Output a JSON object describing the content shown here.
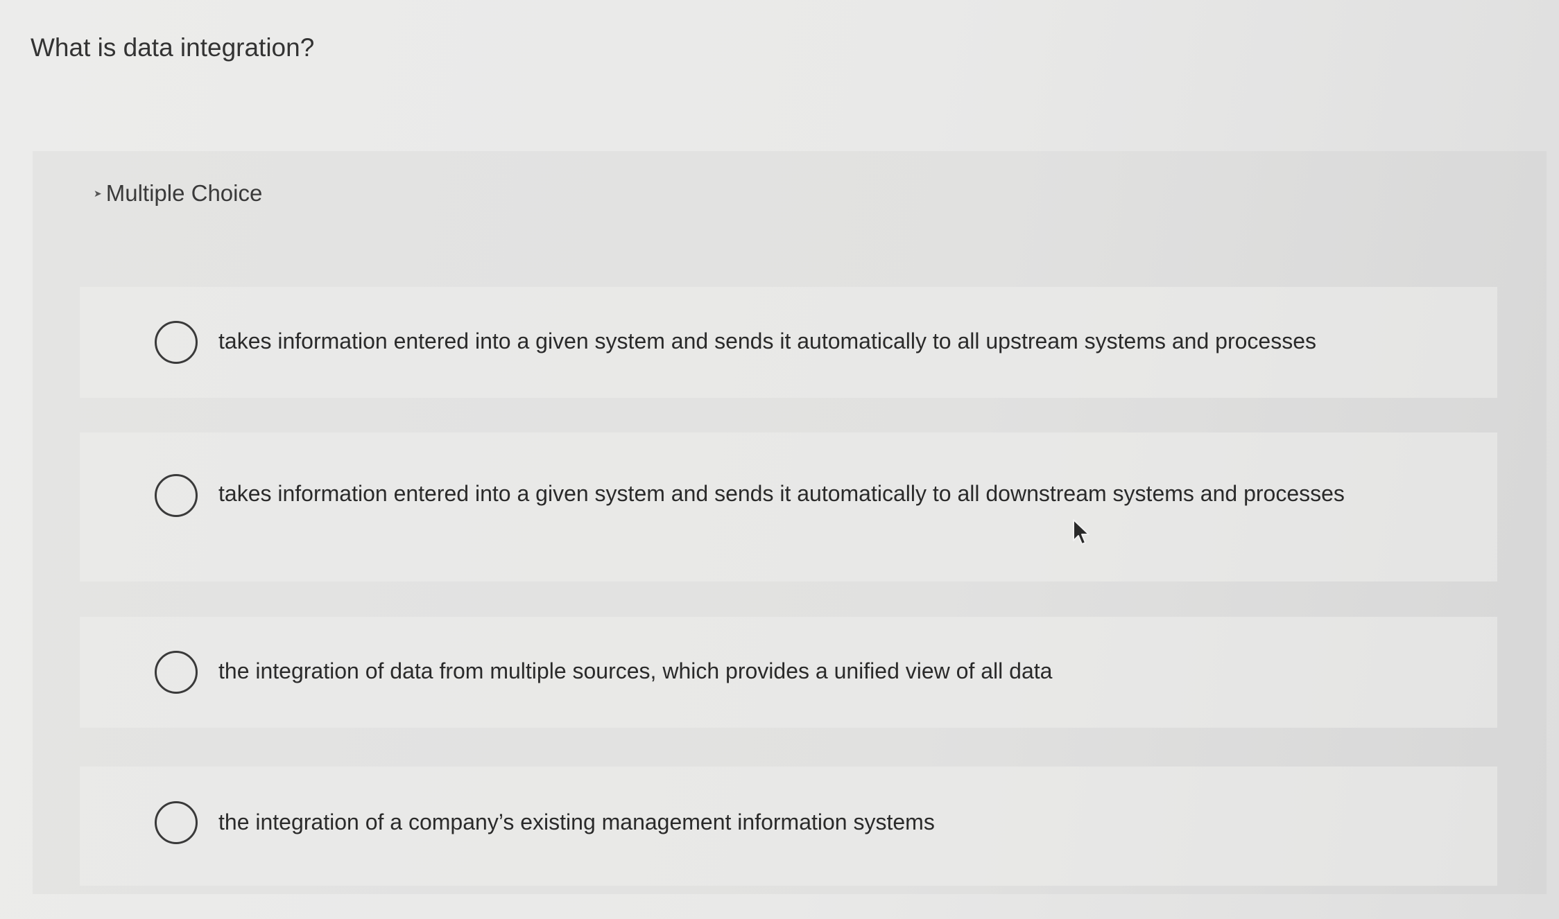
{
  "question": {
    "text": "What is data integration?"
  },
  "question_type": {
    "label": "Multiple Choice"
  },
  "options": [
    {
      "label": "takes information entered into a given system and sends it automatically to all upstream systems and processes",
      "selected": false
    },
    {
      "label": "takes information entered into a given system and sends it automatically to all downstream systems and processes",
      "selected": false
    },
    {
      "label": "the integration of data from multiple sources, which provides a unified view of all data",
      "selected": false
    },
    {
      "label": "the integration of a company’s existing management information systems",
      "selected": false
    }
  ],
  "icons": {
    "radio": "radio-unchecked-icon",
    "cursor": "mouse-pointer-icon"
  },
  "colors": {
    "background": "#e9e9e8",
    "panel": "#e1e1e0",
    "text": "#2a2a2a",
    "radio_border": "#3a3a3a"
  }
}
